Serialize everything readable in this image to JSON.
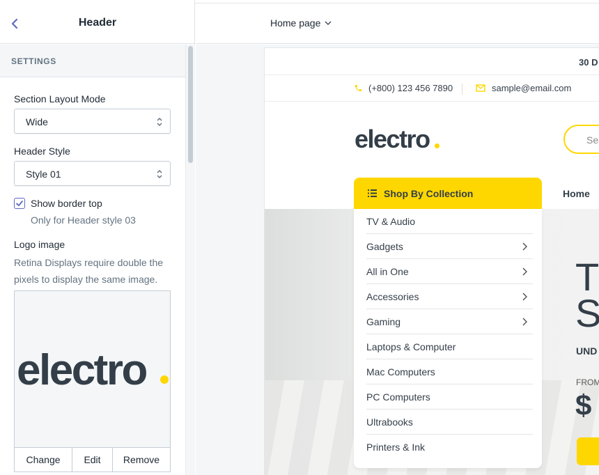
{
  "sidebar": {
    "title": "Header",
    "section": "SETTINGS",
    "layout_mode": {
      "label": "Section Layout Mode",
      "value": "Wide"
    },
    "header_style": {
      "label": "Header Style",
      "value": "Style 01"
    },
    "border_top": {
      "label": "Show border top",
      "checked": true,
      "help": "Only for Header style 03"
    },
    "logo": {
      "label": "Logo image",
      "help_line1": "Retina Displays require double the",
      "help_line2": "pixels to display the same image.",
      "image_text": "electro",
      "buttons": [
        "Change",
        "Edit",
        "Remove"
      ]
    }
  },
  "topbar": {
    "page_select": "Home page"
  },
  "preview": {
    "promo": "30 D",
    "phone": "(+800) 123 456 7890",
    "email": "sample@email.com",
    "logo_text": "electro",
    "search_placeholder": "Sea",
    "shop_by": "Shop By Collection",
    "nav_home": "Home",
    "categories": [
      {
        "label": "TV & Audio",
        "has_children": false
      },
      {
        "label": "Gadgets",
        "has_children": true
      },
      {
        "label": "All in One",
        "has_children": true
      },
      {
        "label": "Accessories",
        "has_children": true
      },
      {
        "label": "Gaming",
        "has_children": true
      },
      {
        "label": "Laptops & Computer",
        "has_children": false
      },
      {
        "label": "Mac Computers",
        "has_children": false
      },
      {
        "label": "PC Computers",
        "has_children": false
      },
      {
        "label": "Ultrabooks",
        "has_children": false
      },
      {
        "label": "Printers & Ink",
        "has_children": false
      }
    ],
    "hero": {
      "line1": "T",
      "line2": "S",
      "sub": "UND",
      "from": "FROM",
      "price": "$"
    }
  },
  "colors": {
    "accent": "#fed700",
    "checkbox": "#5c6ac4",
    "back_arrow": "#5c6ac4"
  }
}
